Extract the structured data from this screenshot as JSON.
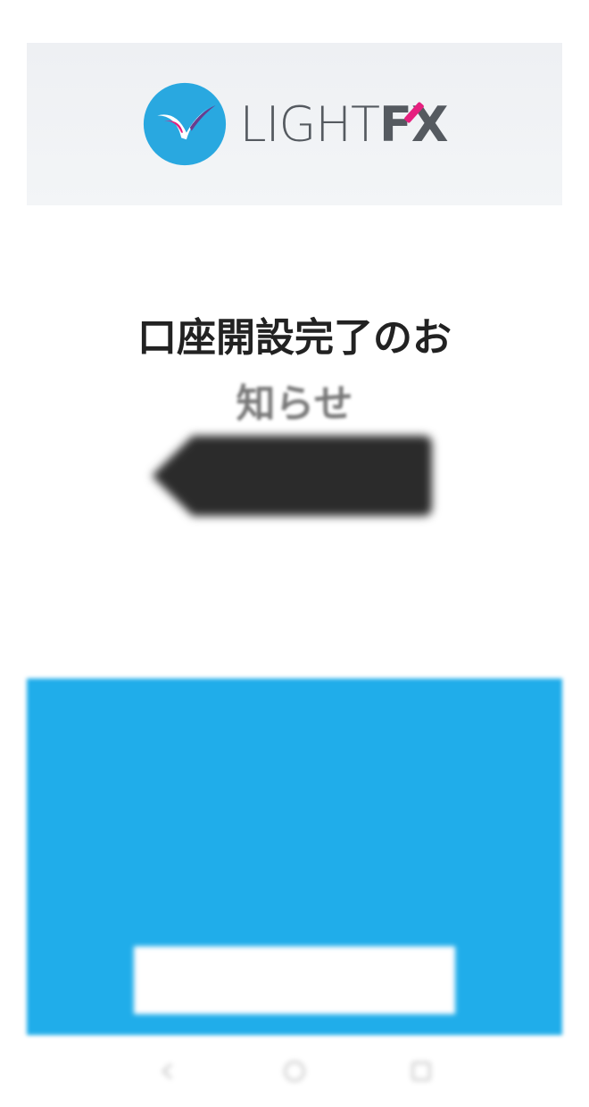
{
  "logo": {
    "text_light": "LIGHT",
    "text_fx": "FX",
    "colors": {
      "circle": "#29a8e0",
      "check_pink": "#e6207f",
      "check_purple": "#6a3c8e",
      "text": "#555a60"
    }
  },
  "title": {
    "line1": "口座開設完了のお",
    "line2": "知らせ"
  },
  "notice_tag": {
    "line1": "",
    "line2": "",
    "colors": {
      "background": "#2b2b2b",
      "text": "#4ad05a"
    }
  },
  "intro": {
    "line1": "",
    "line2": ""
  },
  "card": {
    "color": "#20adea",
    "heading": "",
    "lines": [
      "",
      "",
      "",
      "",
      ""
    ],
    "login_button_label": ""
  },
  "nav": {
    "icons": [
      "back-icon",
      "home-icon",
      "recent-apps-icon"
    ]
  }
}
